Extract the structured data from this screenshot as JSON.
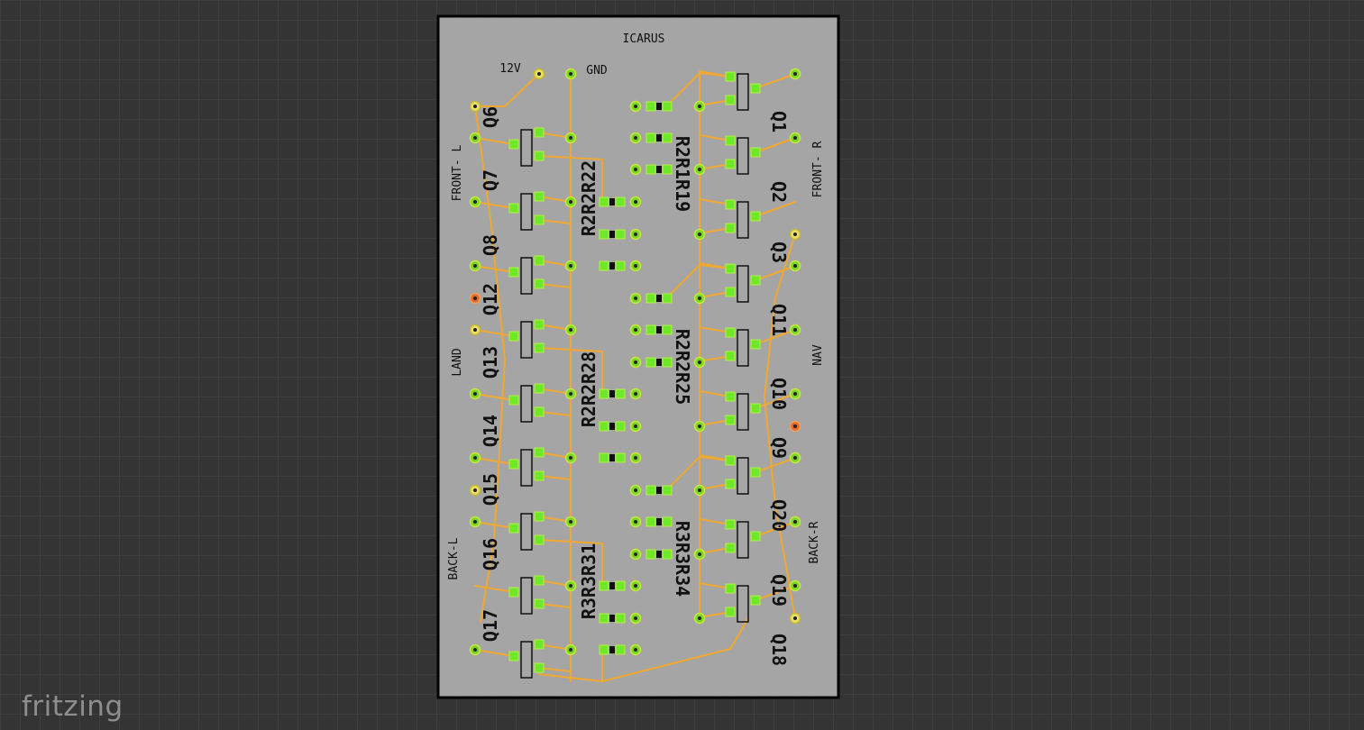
{
  "app": {
    "logo_text": "fritzing"
  },
  "board": {
    "title": "ICARUS",
    "labels": {
      "power_12v": "12V",
      "power_gnd": "GND",
      "front_left": "FRONT- L",
      "front_right": "FRONT- R",
      "land": "LAND",
      "nav": "NAV",
      "back_left": "BACK-L",
      "back_right": "BACK-R"
    },
    "left_transistors": [
      "Q6",
      "Q7",
      "Q8",
      "Q12",
      "Q13",
      "Q14",
      "Q15",
      "Q16",
      "Q17"
    ],
    "right_transistors": [
      "Q1",
      "Q2",
      "Q3",
      "Q11",
      "Q10",
      "Q9",
      "Q20",
      "Q19",
      "Q18"
    ],
    "left_resistor_labels": [
      "R2R2R22",
      "R2R2R28",
      "R3R3R31"
    ],
    "right_resistor_labels": [
      "R2R1R19",
      "R2R2R25",
      "R3R3R34"
    ]
  },
  "colors": {
    "background": "#343434",
    "board_fill": "#a5a5a5",
    "trace": "#f0a830",
    "pad": "#7bd62a",
    "pad_highlight": "#e86a2a",
    "silkscreen": "#111111"
  }
}
